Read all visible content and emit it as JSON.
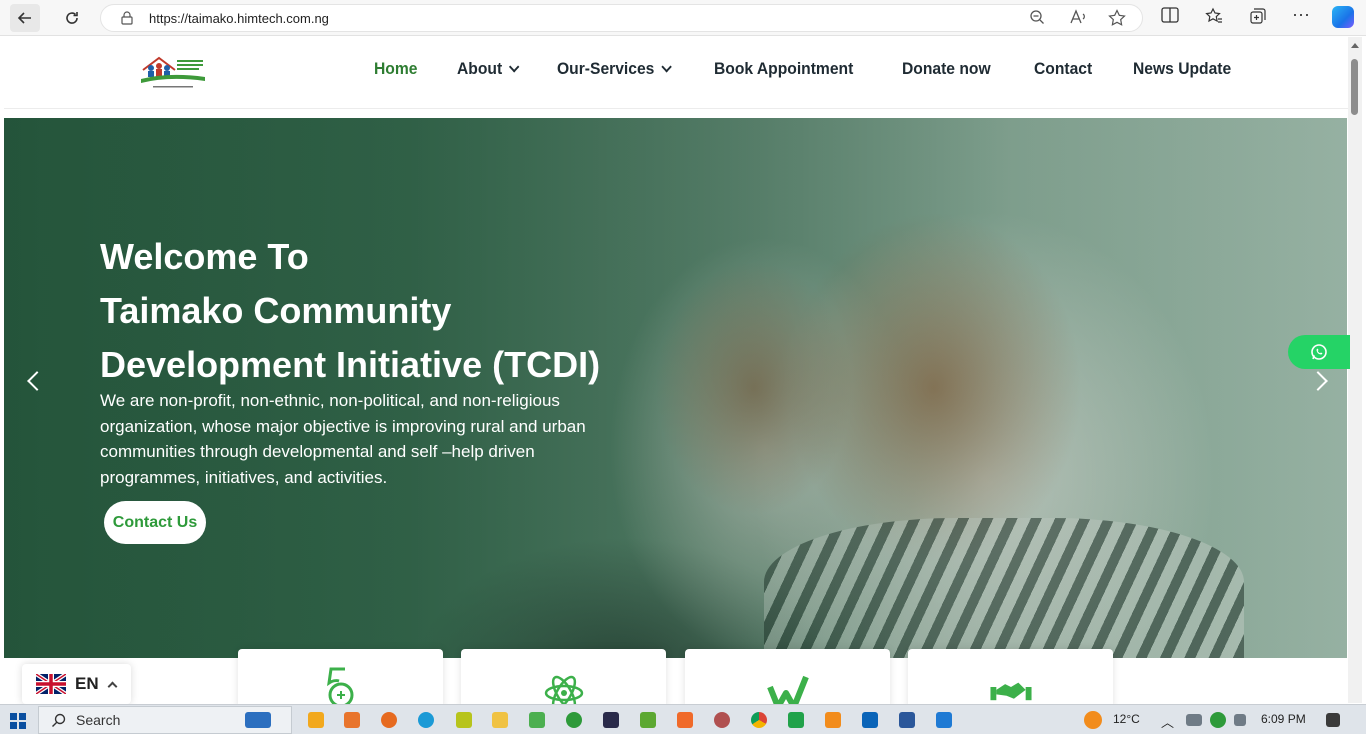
{
  "browser": {
    "url": "https://taimako.himtech.com.ng"
  },
  "nav": {
    "items": [
      {
        "label": "Home",
        "active": true,
        "dropdown": false
      },
      {
        "label": "About",
        "active": false,
        "dropdown": true
      },
      {
        "label": "Our-Services",
        "active": false,
        "dropdown": true
      },
      {
        "label": "Book Appointment",
        "active": false,
        "dropdown": false
      },
      {
        "label": "Donate now",
        "active": false,
        "dropdown": false
      },
      {
        "label": "Contact",
        "active": false,
        "dropdown": false
      },
      {
        "label": "News Update",
        "active": false,
        "dropdown": false
      }
    ]
  },
  "hero": {
    "title_line1": "Welcome To",
    "title_line2": "Taimako Community",
    "title_line3": "Development Initiative (TCDI)",
    "description": "We are non-profit, non-ethnic, non-political, and non-religious organization, whose major objective is improving rural and urban communities through developmental and self –help driven programmes, initiatives, and activities.",
    "cta_label": "Contact Us"
  },
  "language": {
    "code": "EN"
  },
  "taskbar": {
    "search_label": "Search",
    "temperature": "12°C",
    "time": "6:09 PM"
  },
  "colors": {
    "brand_green": "#2e7d32",
    "whatsapp_green": "#25d366"
  }
}
